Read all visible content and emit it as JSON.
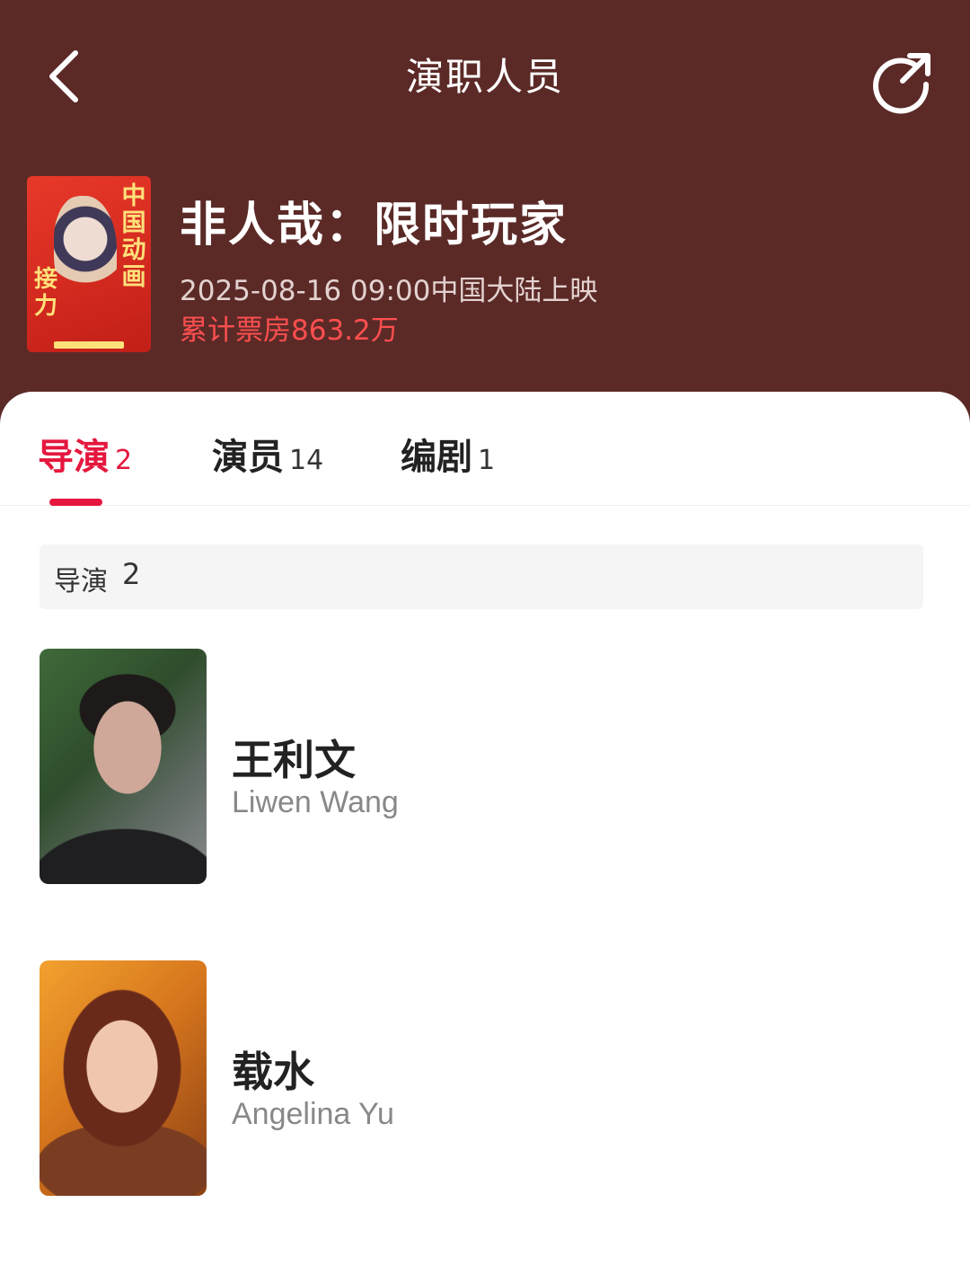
{
  "header": {
    "title": "演职人员",
    "back_icon": "chevron-left-icon",
    "share_icon": "share-icon"
  },
  "movie": {
    "title": "非人哉：限时玩家",
    "release": "2025-08-16 09:00中国大陆上映",
    "box_office": "累计票房863.2万",
    "poster_text_right": "中国动画",
    "poster_text_left": "接力"
  },
  "tabs": [
    {
      "label": "导演",
      "count": "2",
      "active": true
    },
    {
      "label": "演员",
      "count": "14",
      "active": false
    },
    {
      "label": "编剧",
      "count": "1",
      "active": false
    }
  ],
  "section": {
    "label": "导演",
    "count": "2"
  },
  "people": [
    {
      "name": "王利文",
      "english_name": "Liwen Wang"
    },
    {
      "name": "载水",
      "english_name": "Angelina Yu"
    }
  ],
  "colors": {
    "header_bg": "#5b2a27",
    "accent": "#e5173e",
    "box_office": "#ff4f4f"
  }
}
